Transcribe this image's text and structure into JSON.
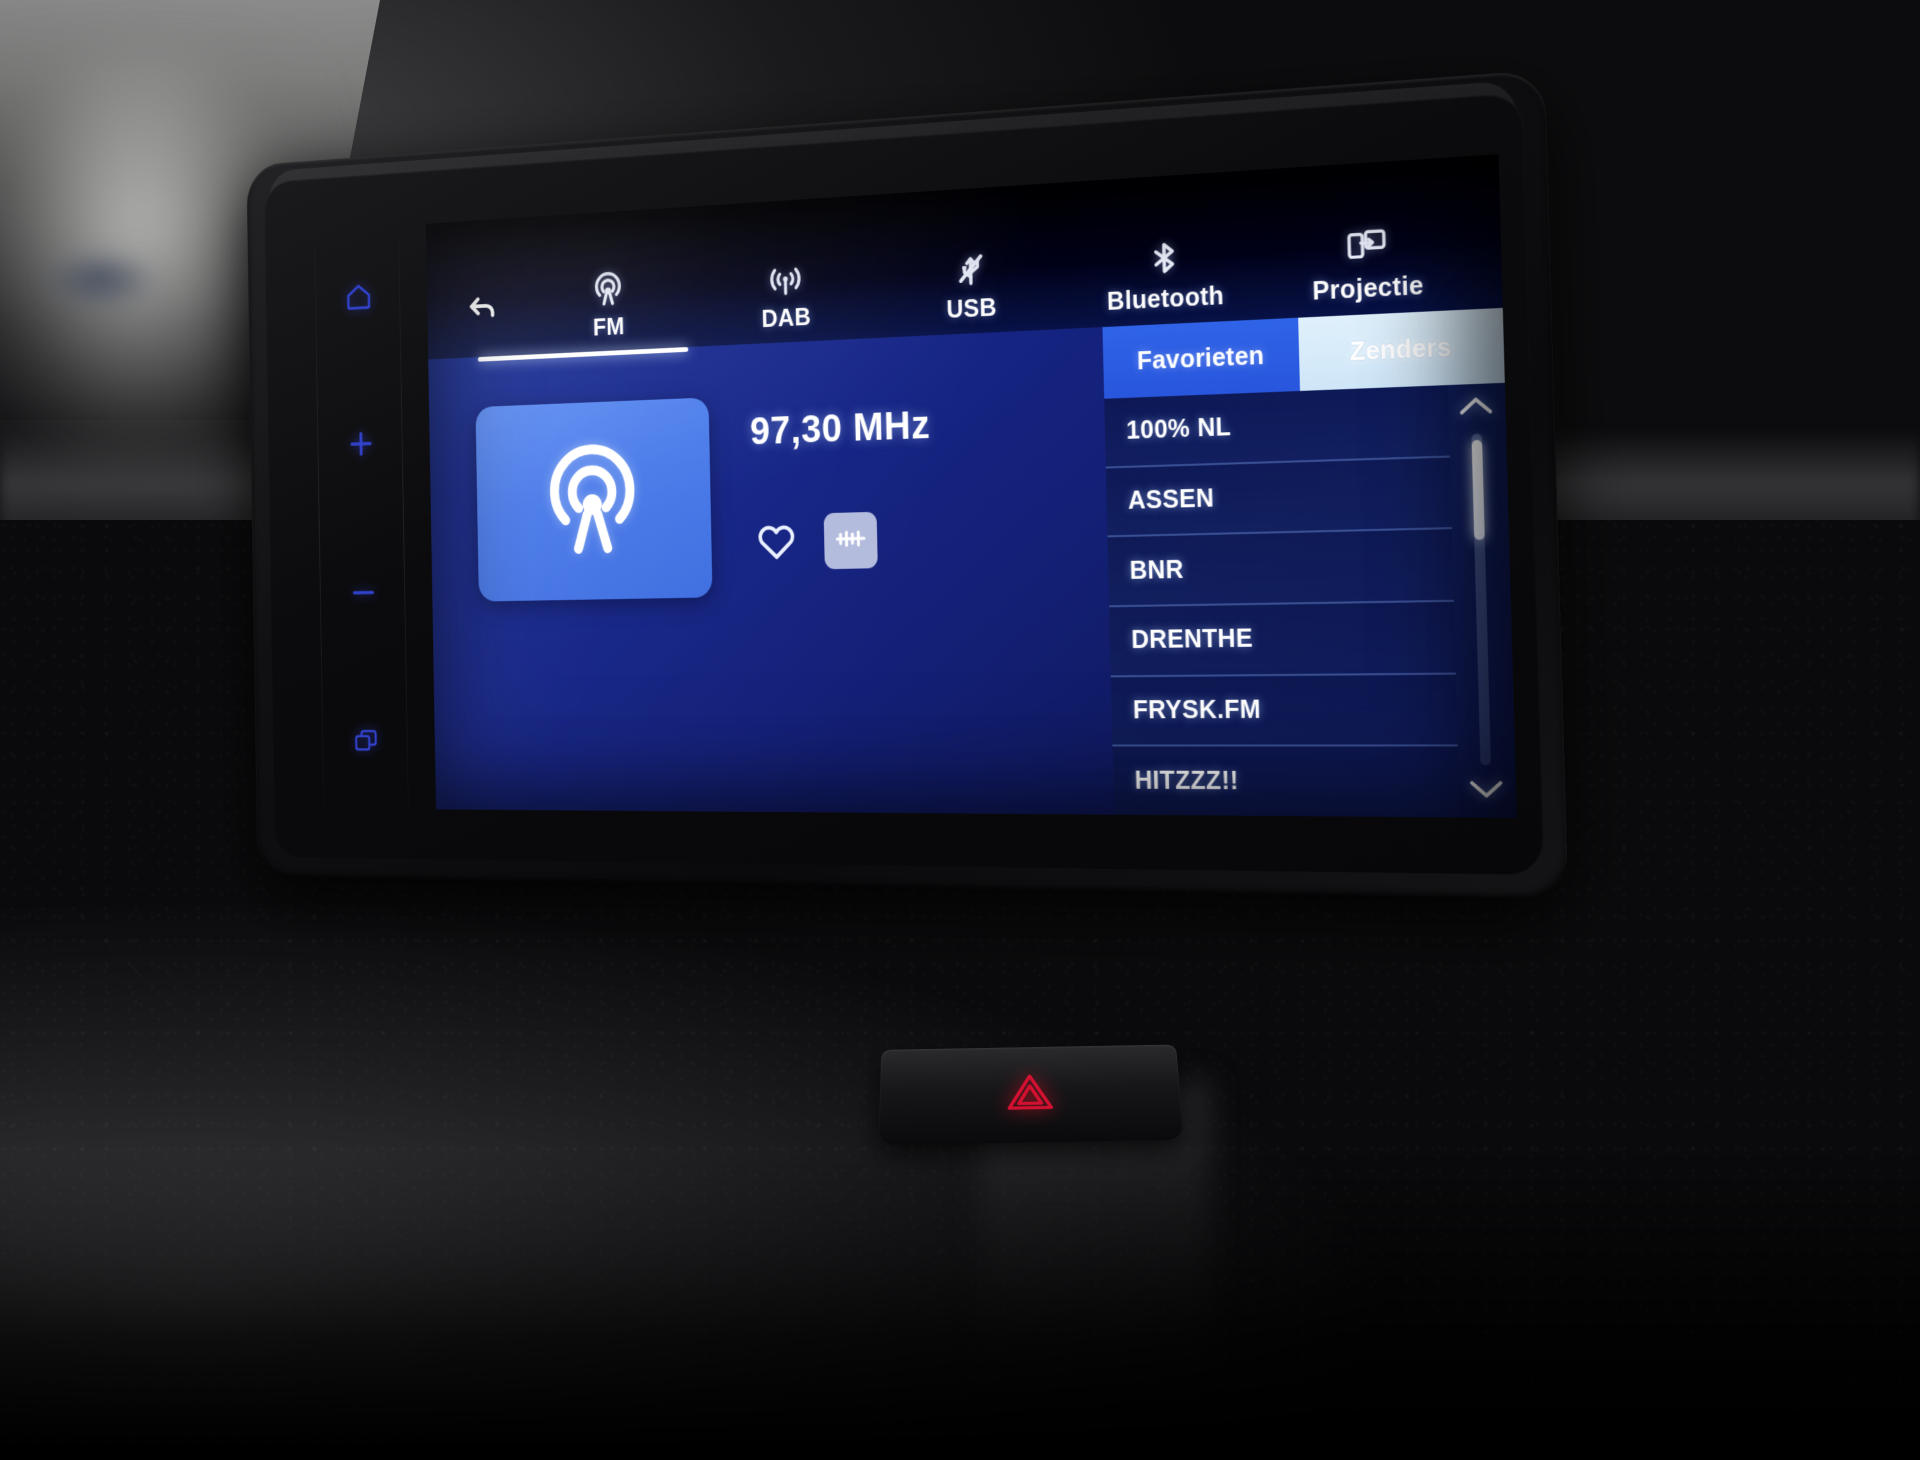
{
  "device": {
    "name": "Car infotainment head unit",
    "hardware_buttons": [
      {
        "name": "home",
        "icon": "home-icon"
      },
      {
        "name": "volume-up",
        "icon": "plus-icon"
      },
      {
        "name": "volume-down",
        "icon": "minus-icon"
      },
      {
        "name": "apps",
        "icon": "windows-stack-icon"
      }
    ],
    "hazard_button": {
      "icon": "hazard-triangle-icon",
      "color": "#c8102e"
    },
    "accent_blue": "#2f63e8",
    "screen_bg": "#16268a"
  },
  "source_bar": {
    "back_button": {
      "label": "",
      "icon": "back-arrow-icon"
    },
    "items": [
      {
        "label": "FM",
        "icon": "radio-antenna-icon",
        "active": true
      },
      {
        "label": "DAB",
        "icon": "dab-broadcast-icon",
        "active": false
      },
      {
        "label": "USB",
        "icon": "usb-muted-icon",
        "active": false
      },
      {
        "label": "Bluetooth",
        "icon": "bluetooth-icon",
        "active": false
      },
      {
        "label": "Projectie",
        "icon": "screen-projection-icon",
        "active": false
      }
    ]
  },
  "now_playing": {
    "artwork_icon": "radio-antenna-icon",
    "frequency": "97,30 MHz",
    "favorite_button": {
      "icon": "heart-outline-icon",
      "active": false
    },
    "equalizer_button": {
      "icon": "audio-waveform-icon",
      "active": true
    }
  },
  "list_panel": {
    "tabs": [
      {
        "label": "Favorieten",
        "selected": false
      },
      {
        "label": "Zenders",
        "selected": true
      }
    ],
    "stations": [
      {
        "name": "100% NL"
      },
      {
        "name": "ASSEN"
      },
      {
        "name": "BNR"
      },
      {
        "name": "DRENTHE"
      },
      {
        "name": "FRYSK.FM"
      },
      {
        "name": "HITZZZ!!"
      }
    ],
    "scroll": {
      "up_icon": "chevron-up-icon",
      "down_icon": "chevron-down-icon",
      "thumb_position_pct": 2,
      "thumb_size_pct": 30
    }
  }
}
